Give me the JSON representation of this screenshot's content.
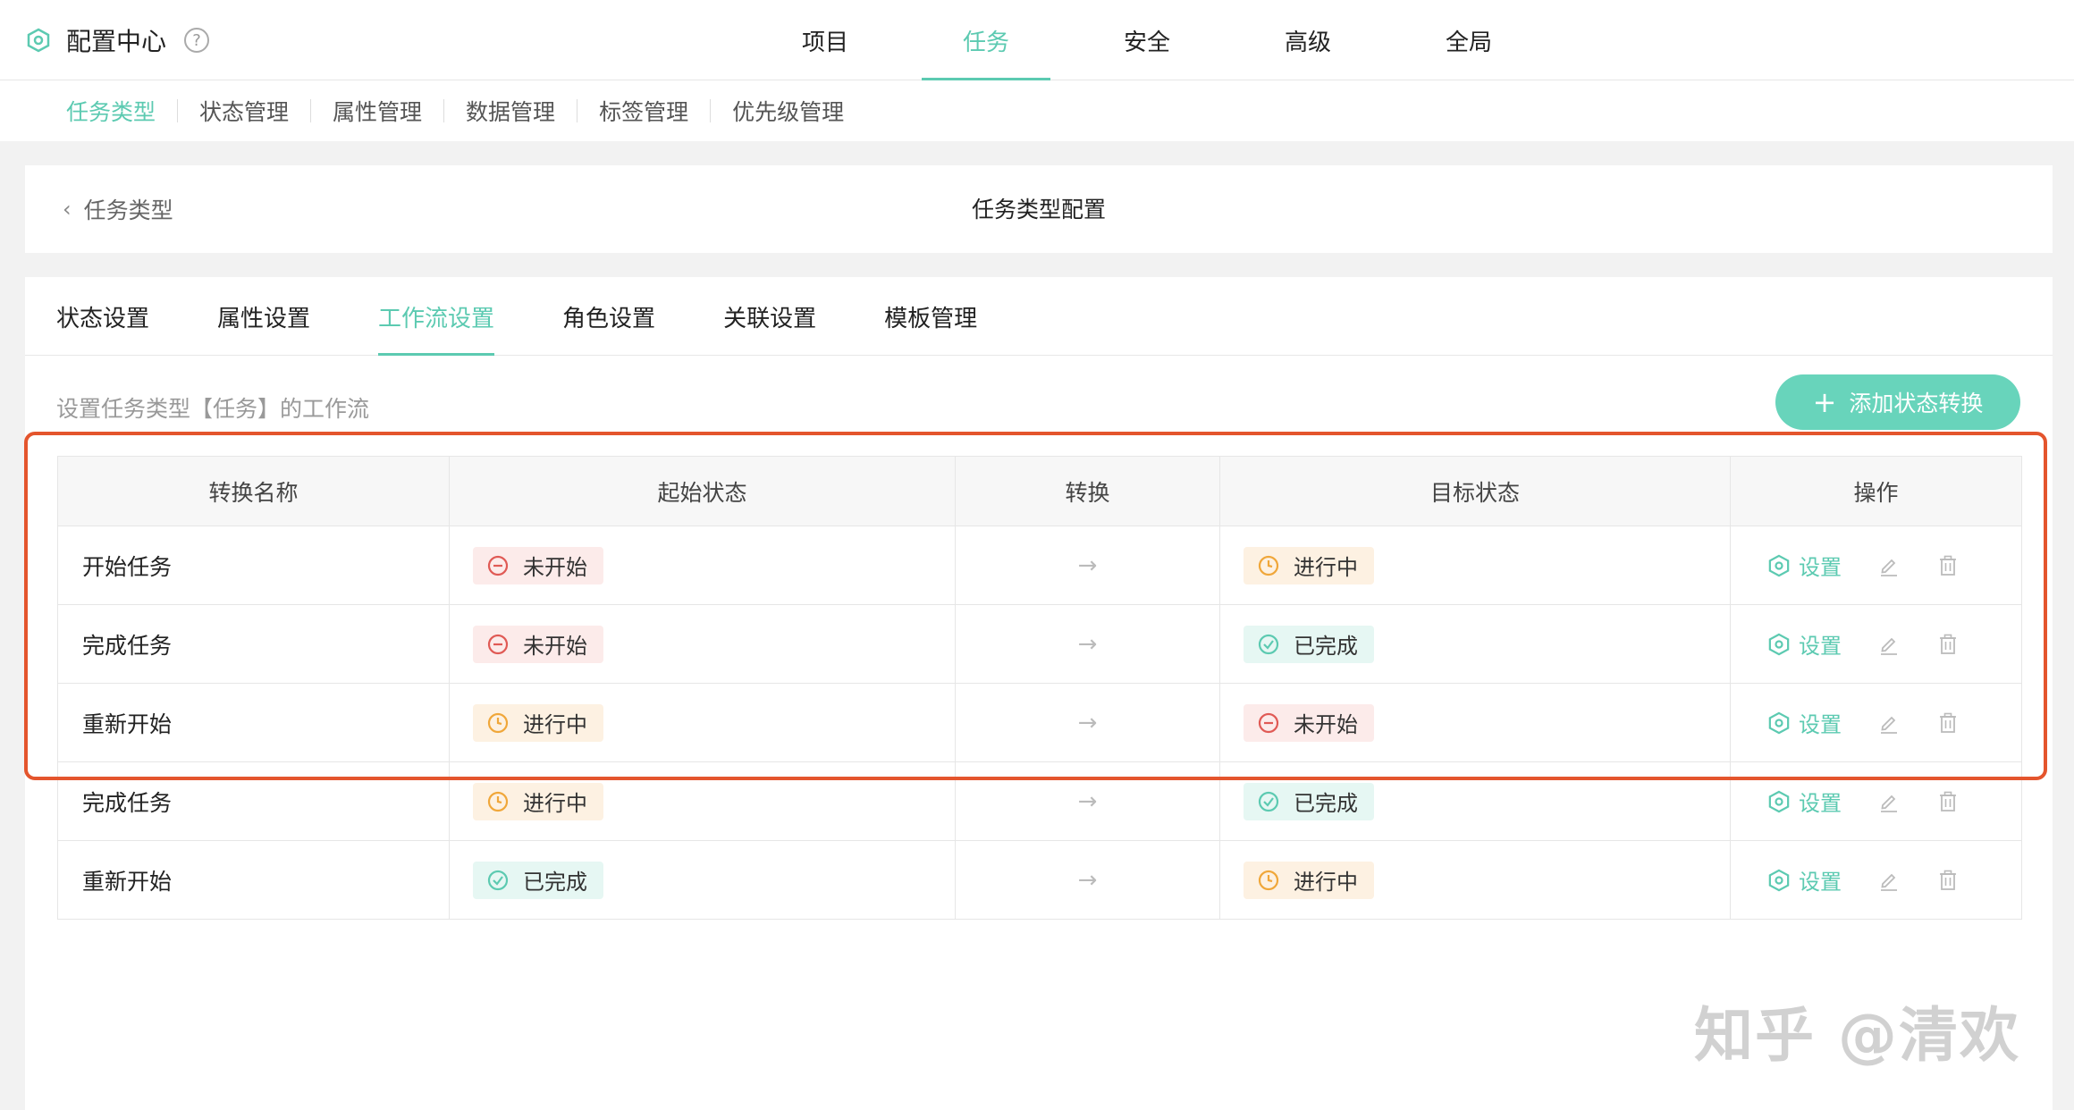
{
  "header": {
    "app_title": "配置中心",
    "help_icon": "?",
    "nav": [
      {
        "label": "项目",
        "active": false
      },
      {
        "label": "任务",
        "active": true
      },
      {
        "label": "安全",
        "active": false
      },
      {
        "label": "高级",
        "active": false
      },
      {
        "label": "全局",
        "active": false
      }
    ]
  },
  "subnav": {
    "items": [
      {
        "label": "任务类型",
        "active": true
      },
      {
        "label": "状态管理",
        "active": false
      },
      {
        "label": "属性管理",
        "active": false
      },
      {
        "label": "数据管理",
        "active": false
      },
      {
        "label": "标签管理",
        "active": false
      },
      {
        "label": "优先级管理",
        "active": false
      }
    ]
  },
  "page": {
    "back_label": "任务类型",
    "title": "任务类型配置"
  },
  "tabs": [
    {
      "label": "状态设置",
      "active": false
    },
    {
      "label": "属性设置",
      "active": false
    },
    {
      "label": "工作流设置",
      "active": true
    },
    {
      "label": "角色设置",
      "active": false
    },
    {
      "label": "关联设置",
      "active": false
    },
    {
      "label": "模板管理",
      "active": false
    }
  ],
  "workflow": {
    "description": "设置任务类型【任务】的工作流",
    "add_button": "添加状态转换",
    "columns": [
      "转换名称",
      "起始状态",
      "转换",
      "目标状态",
      "操作"
    ],
    "rows": [
      {
        "name": "开始任务",
        "from": "未开始",
        "from_type": "red",
        "arrow": "→",
        "to": "进行中",
        "to_type": "orange"
      },
      {
        "name": "完成任务",
        "from": "未开始",
        "from_type": "red",
        "arrow": "→",
        "to": "已完成",
        "to_type": "green"
      },
      {
        "name": "重新开始",
        "from": "进行中",
        "from_type": "orange",
        "arrow": "→",
        "to": "未开始",
        "to_type": "red"
      },
      {
        "name": "完成任务",
        "from": "进行中",
        "from_type": "orange",
        "arrow": "→",
        "to": "已完成",
        "to_type": "green"
      },
      {
        "name": "重新开始",
        "from": "已完成",
        "from_type": "green",
        "arrow": "→",
        "to": "进行中",
        "to_type": "orange"
      }
    ],
    "action_set_label": "设置"
  },
  "status_icons": {
    "red": "minus-circle-icon",
    "orange": "clock-icon",
    "green": "check-circle-icon"
  },
  "colors": {
    "accent": "#5ccab1",
    "button": "#68d4bb",
    "highlight_border": "#e4552d",
    "red": "#e05a55",
    "orange": "#f0a73a",
    "green": "#5ccab1"
  },
  "watermark": "知乎 @清欢"
}
